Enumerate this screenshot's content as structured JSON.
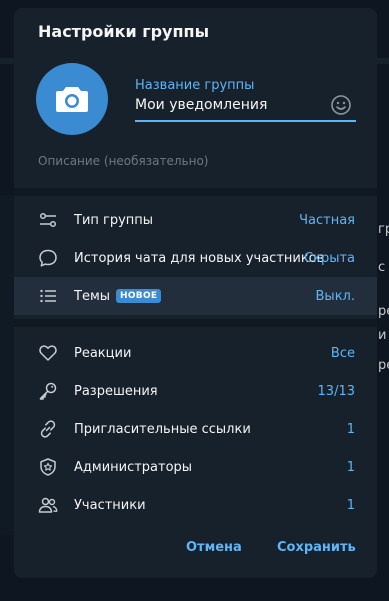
{
  "background": {
    "right_snippets": [
      "гр",
      "с",
      "ре",
      "и",
      "ре"
    ]
  },
  "dialog": {
    "title": "Настройки группы",
    "name_label": "Название группы",
    "name_value": "Мои уведомления",
    "description_placeholder": "Описание (необязательно)"
  },
  "rows_group1": [
    {
      "label": "Тип группы",
      "value": "Частная",
      "icon": "settings-sliders-icon"
    },
    {
      "label": "История чата для новых участников",
      "value": "Скрыта",
      "icon": "chat-bubble-icon"
    },
    {
      "label": "Темы",
      "badge": "НОВОЕ",
      "value": "Выкл.",
      "icon": "topics-list-icon"
    }
  ],
  "rows_group2": [
    {
      "label": "Реакции",
      "value": "Все",
      "icon": "heart-icon"
    },
    {
      "label": "Разрешения",
      "value": "13/13",
      "icon": "key-icon"
    },
    {
      "label": "Пригласительные ссылки",
      "value": "1",
      "icon": "link-icon"
    },
    {
      "label": "Администраторы",
      "value": "1",
      "icon": "admin-shield-icon"
    },
    {
      "label": "Участники",
      "value": "1",
      "icon": "members-icon"
    }
  ],
  "buttons": {
    "cancel": "Отмена",
    "save": "Сохранить"
  },
  "colors": {
    "accent": "#5eb5f7",
    "avatar": "#3a8bd2",
    "panel": "#17212b",
    "background": "#0e1621"
  }
}
